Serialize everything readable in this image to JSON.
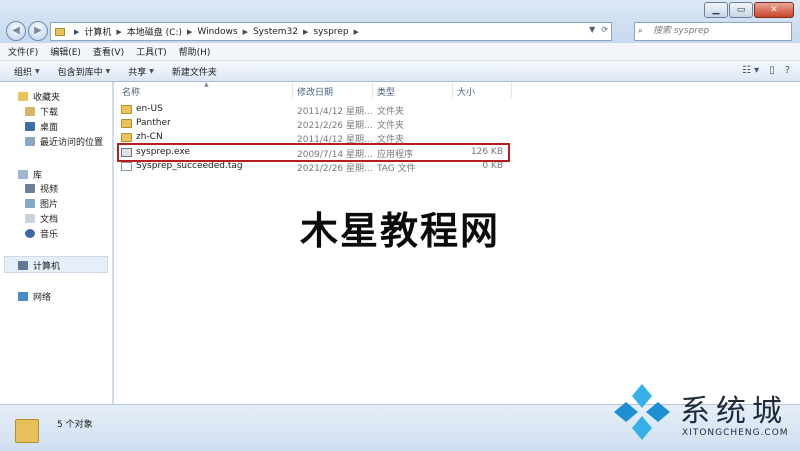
{
  "address": {
    "crumbs": [
      "计算机",
      "本地磁盘 (C:)",
      "Windows",
      "System32",
      "sysprep"
    ]
  },
  "search": {
    "placeholder": "搜索 sysprep"
  },
  "menu": [
    "文件(F)",
    "编辑(E)",
    "查看(V)",
    "工具(T)",
    "帮助(H)"
  ],
  "toolbar": {
    "organize": "组织",
    "include_library": "包含到库中",
    "share": "共享",
    "new_folder": "新建文件夹"
  },
  "nav": {
    "favorites": "收藏夹",
    "downloads": "下载",
    "desktop": "桌面",
    "recent": "最近访问的位置",
    "libraries": "库",
    "videos": "视频",
    "pictures": "图片",
    "documents": "文档",
    "music": "音乐",
    "computer": "计算机",
    "network": "网络"
  },
  "columns": {
    "name": "名称",
    "date": "修改日期",
    "type": "类型",
    "size": "大小"
  },
  "files": [
    {
      "name": "en-US",
      "date": "2011/4/12 星期...",
      "type": "文件夹",
      "size": "",
      "icon": "folder-icon"
    },
    {
      "name": "Panther",
      "date": "2021/2/26 星期...",
      "type": "文件夹",
      "size": "",
      "icon": "folder-icon"
    },
    {
      "name": "zh-CN",
      "date": "2011/4/12 星期...",
      "type": "文件夹",
      "size": "",
      "icon": "folder-icon"
    },
    {
      "name": "sysprep.exe",
      "date": "2009/7/14 星期...",
      "type": "应用程序",
      "size": "126 KB",
      "icon": "exe-icon"
    },
    {
      "name": "Sysprep_succeeded.tag",
      "date": "2021/2/26 星期...",
      "type": "TAG 文件",
      "size": "0 KB",
      "icon": "file-icon"
    }
  ],
  "watermark": "木星教程网",
  "status": {
    "count": "5 个对象"
  },
  "brand": {
    "name": "系统城",
    "site": "XITONGCHENG.COM"
  },
  "colors": {
    "highlight": "#b5201f",
    "folder": "#e9c35c"
  }
}
